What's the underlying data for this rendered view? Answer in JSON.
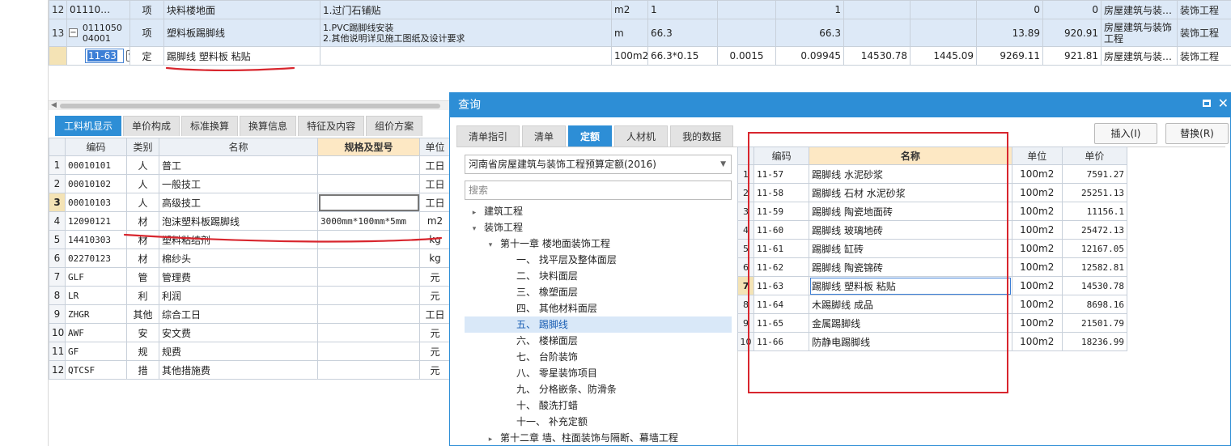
{
  "top_grid": {
    "rows": [
      {
        "idx": "12",
        "code": "01110…",
        "type": "项",
        "name": "块料楼地面",
        "feature": "1.过门石铺贴",
        "unit": "m2",
        "qty_expr": "1",
        "c1": "",
        "qty": "1",
        "c2": "",
        "c3": "",
        "c4": "0",
        "c5": "0",
        "profession": "房屋建筑与装…",
        "work": "装饰工程"
      },
      {
        "idx": "13",
        "code_line1": "0111050",
        "code_line2": "04001",
        "type": "项",
        "name": "塑料板踢脚线",
        "feature_line1": "1.PVC踢脚线安装",
        "feature_line2": "2.其他说明详见施工图纸及设计要求",
        "unit": "m",
        "qty_expr": "66.3",
        "c1": "",
        "qty": "66.3",
        "c2": "",
        "c3": "",
        "c4": "13.89",
        "c5": "920.91",
        "profession_line1": "房屋建筑与装饰",
        "profession_line2": "工程",
        "work": "装饰工程"
      },
      {
        "idx": "",
        "code": "11-63",
        "type": "定",
        "name": "踢脚线 塑料板 粘贴",
        "feature": "",
        "unit": "100m2",
        "qty_expr": "66.3*0.15",
        "c1": "0.0015",
        "qty": "0.09945",
        "c2": "14530.78",
        "c3": "1445.09",
        "c4": "9269.11",
        "c5": "921.81",
        "profession": "房屋建筑与装…",
        "work": "装饰工程"
      }
    ],
    "expand_symbol": "−",
    "dots": "⋯"
  },
  "bottom_tabs": [
    "工料机显示",
    "单价构成",
    "标准换算",
    "换算信息",
    "特征及内容",
    "组价方案"
  ],
  "left_grid": {
    "headers": [
      "编码",
      "类别",
      "名称",
      "规格及型号",
      "单位"
    ],
    "rows": [
      {
        "idx": "1",
        "code": "00010101",
        "cat": "人",
        "name": "普工",
        "spec": "",
        "unit": "工日"
      },
      {
        "idx": "2",
        "code": "00010102",
        "cat": "人",
        "name": "一般技工",
        "spec": "",
        "unit": "工日"
      },
      {
        "idx": "3",
        "code": "00010103",
        "cat": "人",
        "name": "高级技工",
        "spec": "",
        "unit": "工日"
      },
      {
        "idx": "4",
        "code": "12090121",
        "cat": "材",
        "name": "泡沫塑料板踢脚线",
        "spec": "3000mm*100mm*5mm",
        "unit": "m2"
      },
      {
        "idx": "5",
        "code": "14410303",
        "cat": "材",
        "name": "塑料粘结剂",
        "spec": "",
        "unit": "kg"
      },
      {
        "idx": "6",
        "code": "02270123",
        "cat": "材",
        "name": "棉纱头",
        "spec": "",
        "unit": "kg"
      },
      {
        "idx": "7",
        "code": "GLF",
        "cat": "管",
        "name": "管理费",
        "spec": "",
        "unit": "元"
      },
      {
        "idx": "8",
        "code": "LR",
        "cat": "利",
        "name": "利润",
        "spec": "",
        "unit": "元"
      },
      {
        "idx": "9",
        "code": "ZHGR",
        "cat": "其他",
        "name": "综合工日",
        "spec": "",
        "unit": "工日"
      },
      {
        "idx": "10",
        "code": "AWF",
        "cat": "安",
        "name": "安文费",
        "spec": "",
        "unit": "元"
      },
      {
        "idx": "11",
        "code": "GF",
        "cat": "规",
        "name": "规费",
        "spec": "",
        "unit": "元"
      },
      {
        "idx": "12",
        "code": "QTCSF",
        "cat": "措",
        "name": "其他措施费",
        "spec": "",
        "unit": "元"
      }
    ]
  },
  "dialog": {
    "title": "查询",
    "close": "✕",
    "tabs": [
      "清单指引",
      "清单",
      "定额",
      "人材机",
      "我的数据"
    ],
    "insert_button": "插入(I)",
    "replace_button": "替换(R)",
    "library": "河南省房屋建筑与装饰工程预算定额(2016)",
    "search_placeholder": "搜索",
    "tree": [
      {
        "label": "建筑工程",
        "level": 0,
        "toggle": "▸"
      },
      {
        "label": "装饰工程",
        "level": 0,
        "toggle": "▾"
      },
      {
        "label": "第十一章 楼地面装饰工程",
        "level": 1,
        "toggle": "▾"
      },
      {
        "label": "一、 找平层及整体面层",
        "level": 2,
        "toggle": ""
      },
      {
        "label": "二、 块料面层",
        "level": 2,
        "toggle": ""
      },
      {
        "label": "三、 橡塑面层",
        "level": 2,
        "toggle": ""
      },
      {
        "label": "四、 其他材料面层",
        "level": 2,
        "toggle": ""
      },
      {
        "label": "五、 踢脚线",
        "level": 2,
        "toggle": ""
      },
      {
        "label": "六、 楼梯面层",
        "level": 2,
        "toggle": ""
      },
      {
        "label": "七、 台阶装饰",
        "level": 2,
        "toggle": ""
      },
      {
        "label": "八、 零星装饰项目",
        "level": 2,
        "toggle": ""
      },
      {
        "label": "九、 分格嵌条、防滑条",
        "level": 2,
        "toggle": ""
      },
      {
        "label": "十、 酸洗打蜡",
        "level": 2,
        "toggle": ""
      },
      {
        "label": "十一、 补充定额",
        "level": 2,
        "toggle": ""
      },
      {
        "label": "第十二章 墙、柱面装饰与隔断、幕墙工程",
        "level": 1,
        "toggle": "▸"
      }
    ],
    "grid": {
      "headers": [
        "编码",
        "名称",
        "单位",
        "单价"
      ],
      "rows": [
        {
          "idx": "1",
          "code": "11-57",
          "name": "踢脚线 水泥砂浆",
          "unit": "100m2",
          "price": "7591.27"
        },
        {
          "idx": "2",
          "code": "11-58",
          "name": "踢脚线 石材 水泥砂浆",
          "unit": "100m2",
          "price": "25251.13"
        },
        {
          "idx": "3",
          "code": "11-59",
          "name": "踢脚线 陶瓷地面砖",
          "unit": "100m2",
          "price": "11156.1"
        },
        {
          "idx": "4",
          "code": "11-60",
          "name": "踢脚线 玻璃地砖",
          "unit": "100m2",
          "price": "25472.13"
        },
        {
          "idx": "5",
          "code": "11-61",
          "name": "踢脚线 缸砖",
          "unit": "100m2",
          "price": "12167.05"
        },
        {
          "idx": "6",
          "code": "11-62",
          "name": "踢脚线 陶瓷锦砖",
          "unit": "100m2",
          "price": "12582.81"
        },
        {
          "idx": "7",
          "code": "11-63",
          "name": "踢脚线 塑料板 粘贴",
          "unit": "100m2",
          "price": "14530.78"
        },
        {
          "idx": "8",
          "code": "11-64",
          "name": "木踢脚线 成品",
          "unit": "100m2",
          "price": "8698.16"
        },
        {
          "idx": "9",
          "code": "11-65",
          "name": "金属踢脚线",
          "unit": "100m2",
          "price": "21501.79"
        },
        {
          "idx": "10",
          "code": "11-66",
          "name": "防静电踢脚线",
          "unit": "100m2",
          "price": "18236.99"
        }
      ]
    }
  },
  "colors": {
    "accent": "#2d8ed6",
    "annotation_red": "#d8262e",
    "header_highlight": "#fde8c4"
  }
}
